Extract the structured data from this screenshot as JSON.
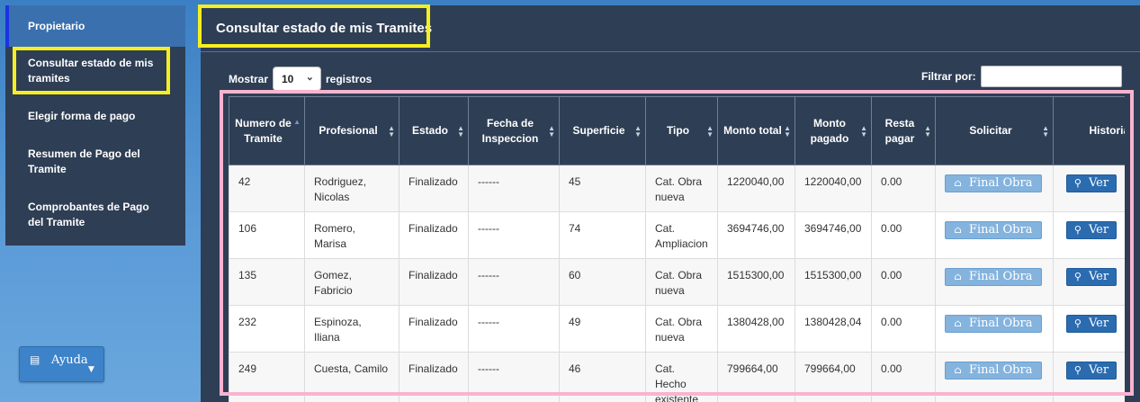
{
  "sidebar": {
    "items": [
      {
        "label": "Propietario"
      },
      {
        "label": "Consultar estado de mis tramites"
      },
      {
        "label": "Elegir forma de pago"
      },
      {
        "label": "Resumen de Pago del Tramite"
      },
      {
        "label": "Comprobantes de Pago del Tramite"
      }
    ],
    "help_label": "Ayuda"
  },
  "main": {
    "title": "Consultar estado de mis Tramites",
    "show_label": "Mostrar",
    "page_length": "10",
    "records_label": "registros",
    "filter_label": "Filtrar por:",
    "filter_value": ""
  },
  "table": {
    "headers": [
      "Numero de Tramite",
      "Profesional",
      "Estado",
      "Fecha de Inspeccion",
      "Superficie",
      "Tipo",
      "Monto total",
      "Monto pagado",
      "Resta pagar",
      "Solicitar",
      "Historial"
    ],
    "rows": [
      {
        "numero": "42",
        "profesional": "Rodriguez, Nicolas",
        "estado": "Finalizado",
        "fecha": "------",
        "superficie": "45",
        "tipo": "Cat. Obra nueva",
        "monto_total": "1220040,00",
        "monto_pagado": "1220040,00",
        "resta": "0.00",
        "solicitar": "Final Obra",
        "historial": "Ver"
      },
      {
        "numero": "106",
        "profesional": "Romero, Marisa",
        "estado": "Finalizado",
        "fecha": "------",
        "superficie": "74",
        "tipo": "Cat. Ampliacion",
        "monto_total": "3694746,00",
        "monto_pagado": "3694746,00",
        "resta": "0.00",
        "solicitar": "Final Obra",
        "historial": "Ver"
      },
      {
        "numero": "135",
        "profesional": "Gomez, Fabricio",
        "estado": "Finalizado",
        "fecha": "------",
        "superficie": "60",
        "tipo": "Cat. Obra nueva",
        "monto_total": "1515300,00",
        "monto_pagado": "1515300,00",
        "resta": "0.00",
        "solicitar": "Final Obra",
        "historial": "Ver"
      },
      {
        "numero": "232",
        "profesional": "Espinoza, Iliana",
        "estado": "Finalizado",
        "fecha": "------",
        "superficie": "49",
        "tipo": "Cat. Obra nueva",
        "monto_total": "1380428,00",
        "monto_pagado": "1380428,04",
        "resta": "0.00",
        "solicitar": "Final Obra",
        "historial": "Ver"
      },
      {
        "numero": "249",
        "profesional": "Cuesta, Camilo",
        "estado": "Finalizado",
        "fecha": "------",
        "superficie": "46",
        "tipo": "Cat. Hecho existente",
        "monto_total": "799664,00",
        "monto_pagado": "799664,00",
        "resta": "0.00",
        "solicitar": "Final Obra",
        "historial": "Ver"
      }
    ]
  },
  "colors": {
    "panel": "#2e3e54",
    "accent_blue": "#2b6cb1",
    "highlight_yellow": "#f7ee22",
    "highlight_pink": "#f9b3cf"
  }
}
